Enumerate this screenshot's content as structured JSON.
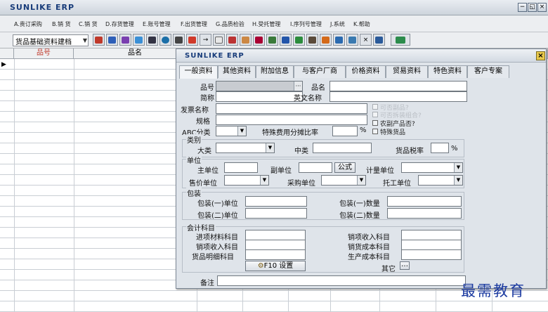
{
  "app": {
    "title": "SUNLIKE ERP"
  },
  "menu": {
    "items": [
      "A.贵订采购",
      "B.销 货",
      "C.销 货",
      "D.存货管理",
      "E.账号管理",
      "F.出货管理",
      "G.品质检验",
      "H.受托管理",
      "I.序列号管理",
      "J.系统",
      "K.帮助"
    ]
  },
  "toolbar": {
    "combo_value": "货品基础资料建档"
  },
  "grid": {
    "columns": [
      "品号",
      "品名"
    ]
  },
  "dialog": {
    "title": "SUNLIKE ERP",
    "tabs": [
      "一般资料",
      "其他资料",
      "附加信息",
      "与客户厂商",
      "价格资料",
      "贸易资料",
      "特色资料",
      "客户专案"
    ],
    "fields": {
      "product_no": "品号",
      "product_name": "品名",
      "short_name": "简称",
      "english_name": "英文名称",
      "invoice_name": "发票名称",
      "spec": "规格",
      "abc_class": "ABC分类",
      "expense_ratio": "特殊费用分摊比率",
      "percent": "%"
    },
    "checkboxes": [
      "可否副品?",
      "可否拆装组合?",
      "农副产品否?",
      "特殊货品"
    ],
    "category": {
      "title": "类别",
      "major": "大类",
      "middle": "中类",
      "tax_rate": "货品税率",
      "percent": "%"
    },
    "unit": {
      "title": "单位",
      "main": "主单位",
      "secondary": "副单位",
      "formula": "公式",
      "measure": "计量单位",
      "sale": "售价单位",
      "purchase": "采购单位",
      "outsource": "托工单位"
    },
    "package": {
      "title": "包装",
      "pack1_unit": "包装(一)单位",
      "pack1_qty": "包装(一)数量",
      "pack2_unit": "包装(二)单位",
      "pack2_qty": "包装(二)数量"
    },
    "accounting": {
      "title": "会计科目",
      "purchase_material": "进项材料科目",
      "sales_income_in": "销项收入科目",
      "goods_detail": "货品明细科目",
      "sales_income": "销项收入科目",
      "sales_cost": "销货成本科目",
      "production_cost": "生产成本科目",
      "other": "其它",
      "f10": "F10 设置"
    },
    "remark": "备注"
  },
  "watermark": "最需教育"
}
